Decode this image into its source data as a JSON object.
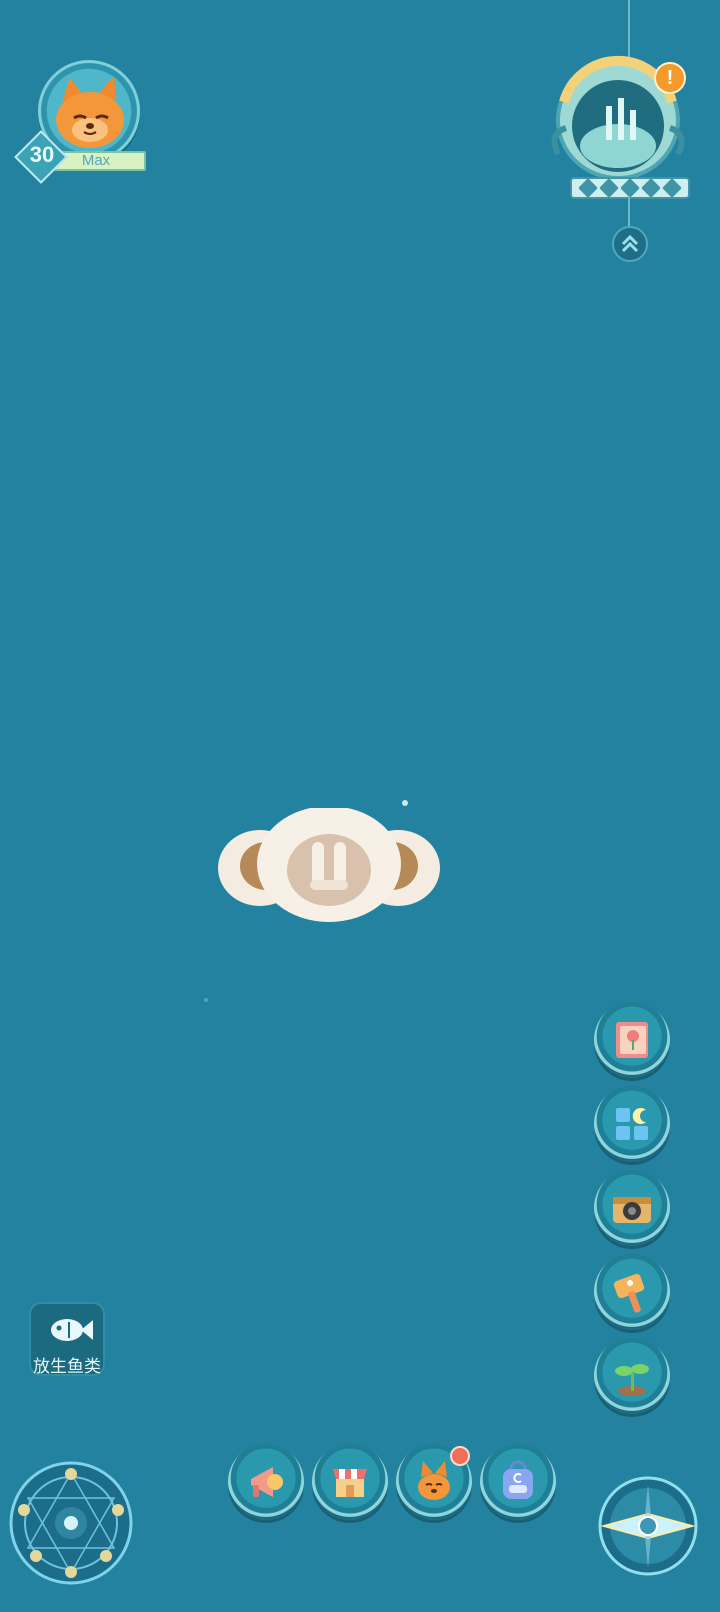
{
  "player": {
    "level": "30",
    "level_status": "Max"
  },
  "buttons": {
    "release_fish_label": "放生鱼类",
    "alert_mark": "!"
  },
  "icons": {
    "side": [
      "flower-book-icon",
      "moon-blocks-icon",
      "camera-icon",
      "hammer-icon",
      "sprout-icon"
    ],
    "bottom": [
      "megaphone-icon",
      "shop-icon",
      "fox-pet-icon",
      "backpack-icon"
    ]
  },
  "colors": {
    "background": "#23829f",
    "accent": "#f39a2a"
  }
}
